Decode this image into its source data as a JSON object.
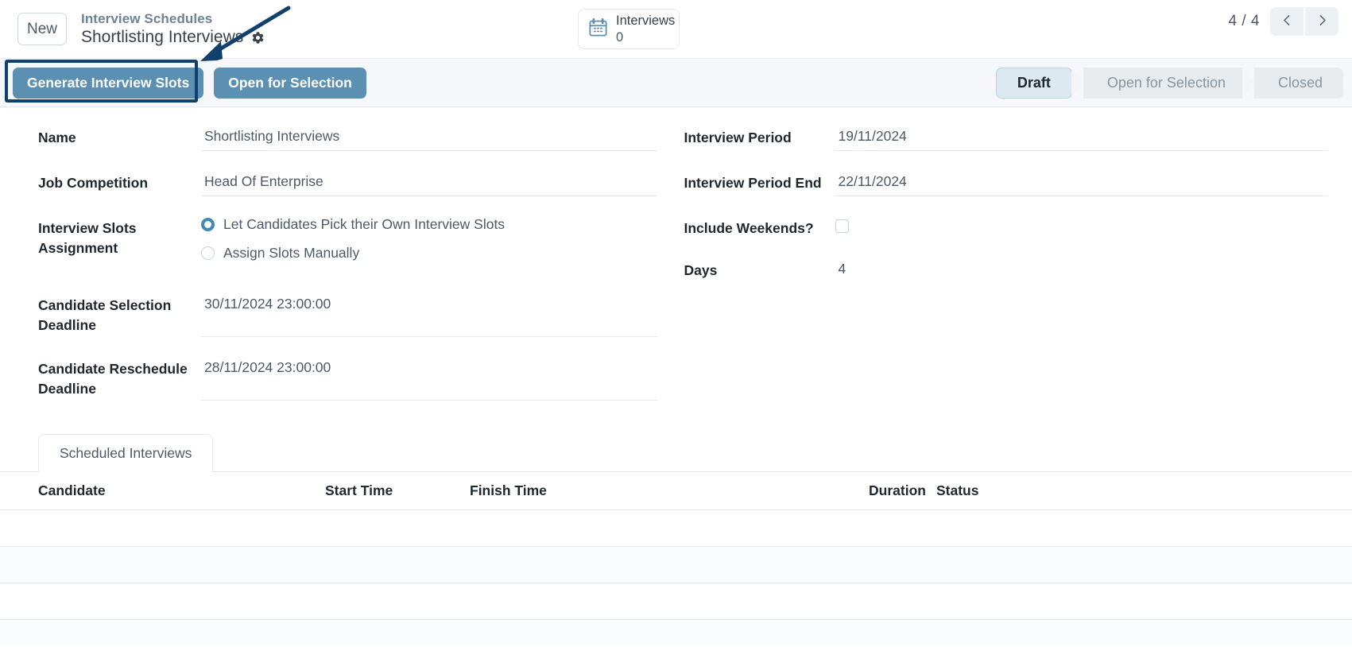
{
  "topbar": {
    "new_button": "New",
    "breadcrumb": "Interview Schedules",
    "doc_title": "Shortlisting Interviews",
    "gear_icon": "gear-icon",
    "indicator": {
      "icon": "calendar-icon",
      "label": "Interviews",
      "count": "0"
    },
    "pager": {
      "count": "4 / 4",
      "prev_icon": "chevron-left-icon",
      "next_icon": "chevron-right-icon"
    }
  },
  "toolbar": {
    "primary_buttons": [
      {
        "label": "Generate Interview Slots",
        "highlighted": true
      },
      {
        "label": "Open for Selection",
        "highlighted": false
      }
    ],
    "button_color": "#5b90b2",
    "highlight_color": "#11406f",
    "pipeline": [
      {
        "label": "Draft",
        "active": true
      },
      {
        "label": "Open for Selection",
        "active": false
      },
      {
        "label": "Closed",
        "active": false
      }
    ],
    "pipeline_active_color": "#dce9f1"
  },
  "form": {
    "left": {
      "name": {
        "label": "Name",
        "value": "Shortlisting Interviews"
      },
      "job_competition": {
        "label": "Job Competition",
        "value": "Head Of Enterprise"
      },
      "slots_assignment": {
        "label": "Interview Slots Assignment",
        "options": [
          {
            "label": "Let Candidates Pick their Own Interview Slots",
            "selected": true
          },
          {
            "label": "Assign Slots Manually",
            "selected": false
          }
        ]
      },
      "selection_deadline": {
        "label": "Candidate Selection Deadline",
        "value": "30/11/2024 23:00:00"
      },
      "reschedule_deadline": {
        "label": "Candidate Reschedule Deadline",
        "value": "28/11/2024 23:00:00"
      }
    },
    "right": {
      "interview_period": {
        "label": "Interview Period",
        "value": "19/11/2024"
      },
      "interview_period_end": {
        "label": "Interview Period End",
        "value": "22/11/2024"
      },
      "include_weekends": {
        "label": "Include Weekends?",
        "checked": false
      },
      "days": {
        "label": "Days",
        "value": "4"
      }
    }
  },
  "grid_section": {
    "tab": "Scheduled Interviews",
    "columns": [
      "Candidate",
      "Start Time",
      "Finish Time",
      "Duration",
      "Status"
    ],
    "rows": []
  }
}
